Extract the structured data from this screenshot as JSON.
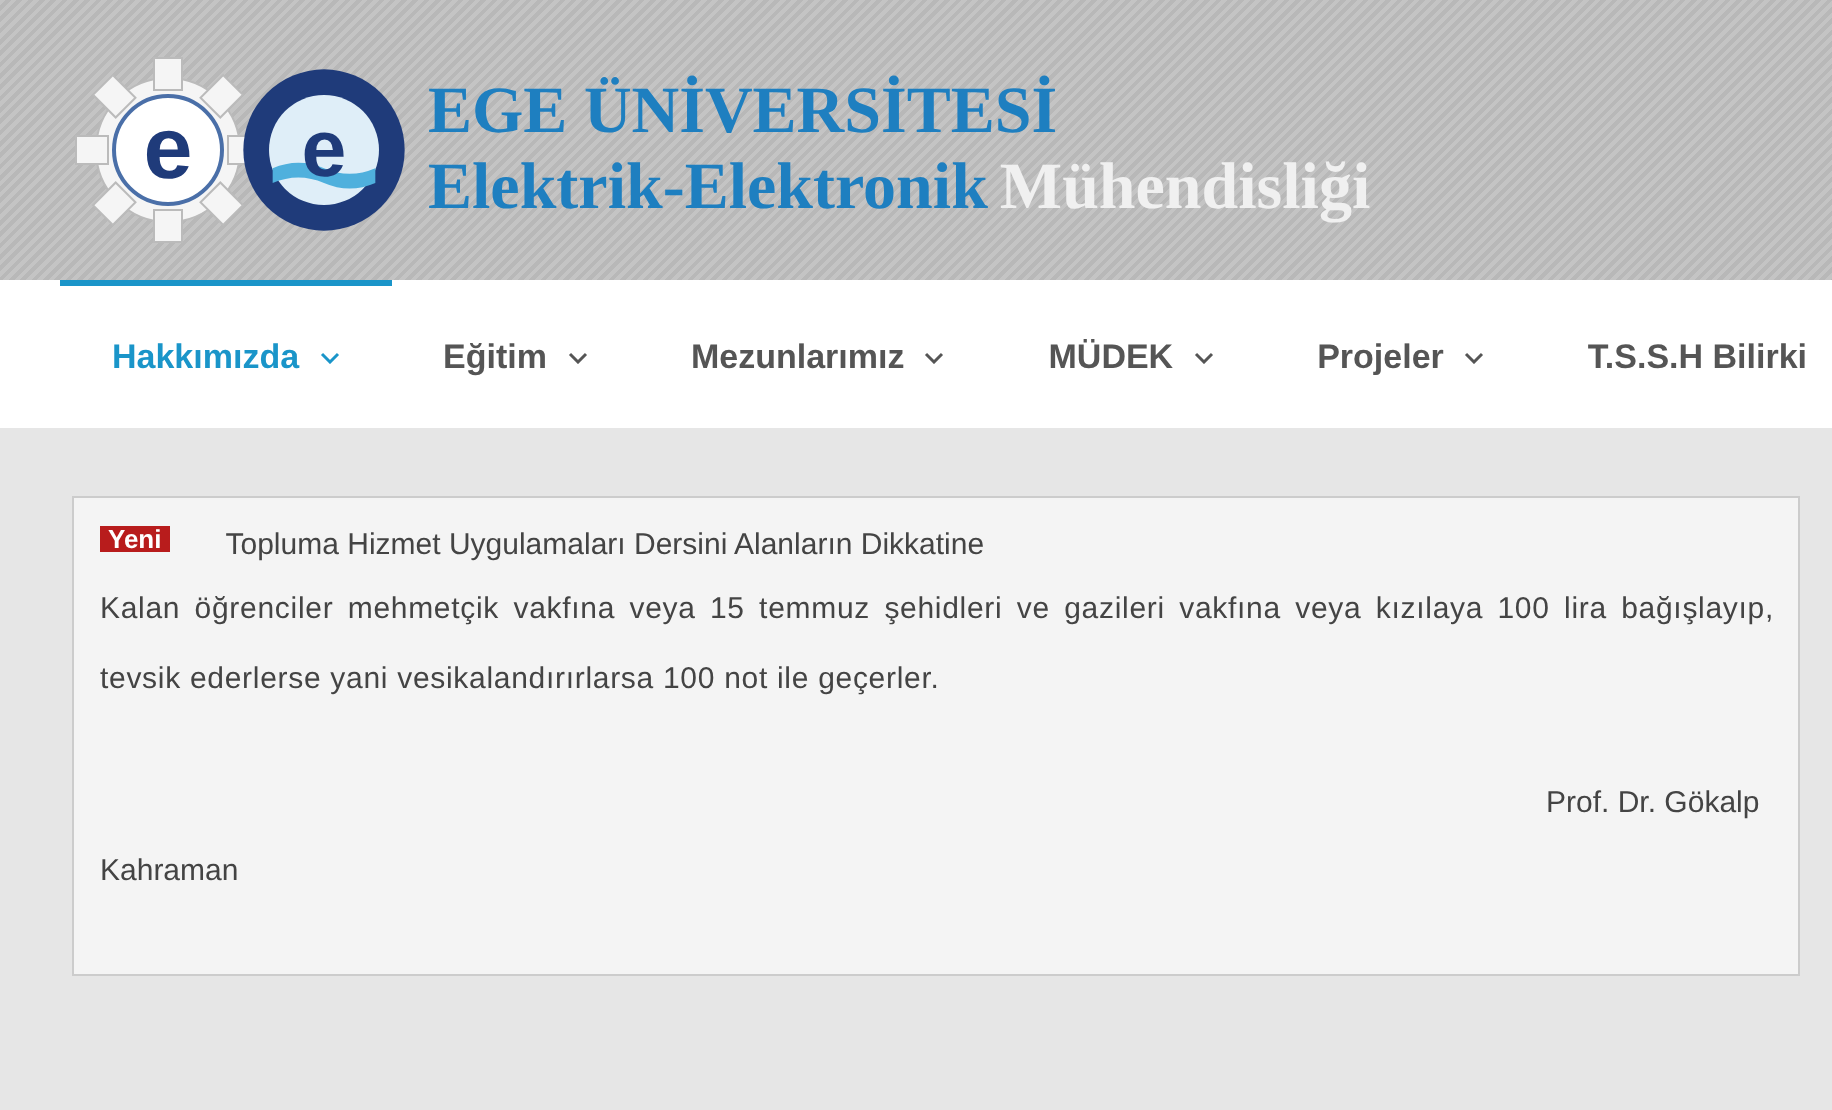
{
  "header": {
    "logos": [
      {
        "letter": "e"
      },
      {
        "letter": "e"
      }
    ],
    "title": "EGE ÜNİVERSİTESİ",
    "subtitle_primary": "Elektrik-Elektronik",
    "subtitle_secondary": "Mühendisliği"
  },
  "nav": [
    {
      "label": "Hakkımızda",
      "selected": true,
      "caret": true
    },
    {
      "label": "Eğitim",
      "selected": false,
      "caret": true
    },
    {
      "label": "Mezunlarımız",
      "selected": false,
      "caret": true
    },
    {
      "label": "MÜDEK",
      "selected": false,
      "caret": true
    },
    {
      "label": "Projeler",
      "selected": false,
      "caret": true
    },
    {
      "label": "T.S.S.H Bilirki",
      "selected": false,
      "caret": false
    }
  ],
  "notice": {
    "badge": "Yeni",
    "title": "Topluma Hizmet Uygulamaları Dersini Alanların Dikkatine",
    "body": "Kalan öğrenciler mehmetçik vakfına veya 15 temmuz şehidleri ve gazileri vakfına veya kızılaya 100 lira bağışlayıp, tevsik ederlerse yani vesikalandırırlarsa 100 not ile geçerler.",
    "signature": "Prof. Dr. Gökalp Kahraman"
  }
}
